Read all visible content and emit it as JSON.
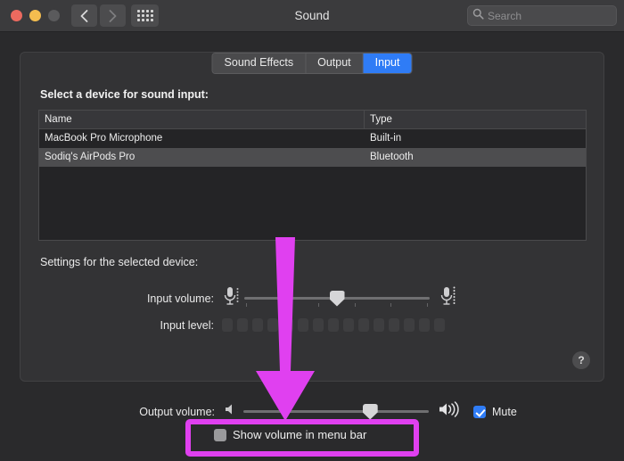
{
  "window": {
    "title": "Sound",
    "traffic_lights": [
      "close",
      "minimize",
      "zoom"
    ],
    "nav": {
      "back": "back-chevron",
      "forward": "forward-chevron",
      "grid": "show-all-grid"
    },
    "search": {
      "value": "",
      "placeholder": "Search",
      "icon": "search-icon"
    }
  },
  "tabs": [
    {
      "label": "Sound Effects",
      "active": false
    },
    {
      "label": "Output",
      "active": false
    },
    {
      "label": "Input",
      "active": true
    }
  ],
  "main": {
    "select_device_label": "Select a device for sound input:",
    "table": {
      "headers": {
        "name": "Name",
        "type": "Type"
      },
      "rows": [
        {
          "name": "MacBook Pro Microphone",
          "type": "Built-in",
          "selected": false
        },
        {
          "name": "Sodiq's AirPods Pro",
          "type": "Bluetooth",
          "selected": true
        }
      ]
    },
    "settings_label": "Settings for the selected device:",
    "input_volume": {
      "label": "Input volume:",
      "value_percent": 50,
      "left_icon": "microphone-low-icon",
      "right_icon": "microphone-high-icon"
    },
    "input_level": {
      "label": "Input level:",
      "segments": 15,
      "active_segments": 0
    },
    "help_button": "?"
  },
  "footer": {
    "output_volume": {
      "label": "Output volume:",
      "value_percent": 70,
      "left_icon": "speaker-low-icon",
      "right_icon": "speaker-high-icon"
    },
    "mute": {
      "label": "Mute",
      "checked": true
    },
    "show_volume_in_menu_bar": {
      "label": "Show volume in menu bar",
      "checked": false
    }
  },
  "annotations": {
    "arrow": {
      "direction": "down",
      "color": "#e040f0"
    },
    "highlight_box": {
      "target": "show-volume-in-menu-bar",
      "color": "#e040f0"
    }
  },
  "colors": {
    "accent_blue": "#2f7cf6",
    "annotation_magenta": "#e040f0",
    "window_bg": "#2a2a2c",
    "panel_bg": "#333335",
    "titlebar_bg": "#3b3b3d"
  }
}
